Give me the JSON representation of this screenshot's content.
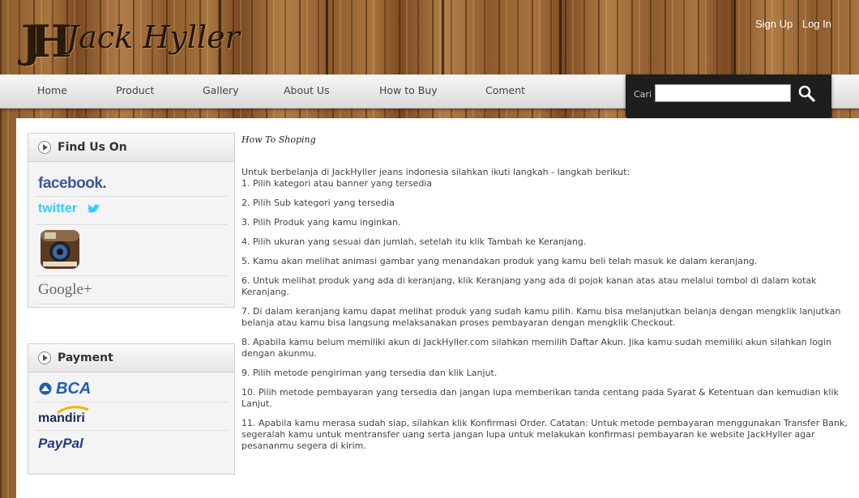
{
  "brand": {
    "name": "Jack Hyller",
    "monogram": "JH"
  },
  "auth": {
    "signup": "Sign Up",
    "login": "Log In"
  },
  "nav": {
    "items": [
      "Home",
      "Product",
      "Gallery",
      "About Us",
      "How to Buy",
      "Coment"
    ]
  },
  "search": {
    "label": "Cari",
    "value": ""
  },
  "sidebar": {
    "find_us": {
      "title": "Find Us On",
      "items": [
        "facebook.",
        "twitter",
        "instagram",
        "Google+"
      ]
    },
    "payment": {
      "title": "Payment",
      "items": [
        "BCA",
        "mandiri",
        "PayPal"
      ]
    }
  },
  "article": {
    "heading": "How To Shoping",
    "intro": "Untuk berbelanja di JackHyller jeans indonesia silahkan ikuti langkah - langkah berikut:",
    "steps": [
      "1. Pilih kategori atau banner yang tersedia",
      "2. Pilih Sub kategori yang tersedia",
      "3. Pilih Produk yang kamu inginkan.",
      "4. Pilih ukuran yang sesuai dan jumlah, setelah itu klik Tambah ke Keranjang.",
      "5. Kamu akan melihat animasi gambar yang menandakan produk yang kamu beli telah masuk ke dalam keranjang.",
      "6. Untuk melihat produk yang ada di keranjang, klik Keranjang yang ada di pojok kanan atas atau melalui tombol di dalam kotak Keranjang.",
      "7. Di dalam keranjang kamu dapat melihat produk yang sudah kamu pilih. Kamu bisa melanjutkan belanja dengan mengklik lanjutkan belanja atau kamu bisa langsung melaksanakan proses pembayaran dengan mengklik Checkout.",
      "8. Apabila kamu belum memiliki akun di JackHyller.com silahkan memilih Daftar Akun. Jika kamu sudah memiliki akun silahkan login dengan akunmu.",
      "9. Pilih metode pengiriman yang tersedia dan klik Lanjut.",
      "10. Pilih metode pembayaran yang tersedia dan jangan lupa memberikan tanda centang pada Syarat & Ketentuan dan kemudian klik Lanjut.",
      "11. Apabila kamu merasa sudah siap, silahkan klik Konfirmasi Order. Catatan: Untuk metode pembayaran menggunakan Transfer Bank, segeralah kamu untuk mentransfer uang serta jangan lupa untuk melakukan konfirmasi pembayaran ke website JackHyller agar pesananmu segera di kirim."
    ]
  },
  "icons": {
    "search": "magnifier-icon",
    "section": "play-arrow-icon"
  }
}
